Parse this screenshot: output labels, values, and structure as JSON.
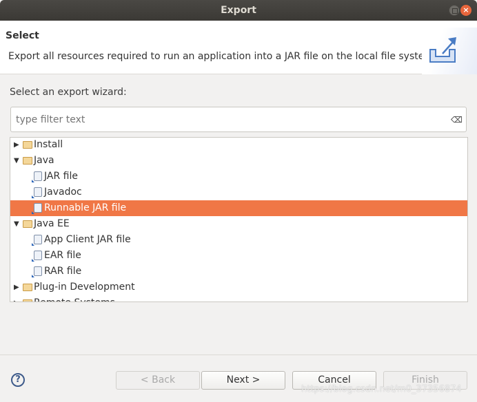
{
  "window": {
    "title": "Export",
    "close_glyph": "×"
  },
  "header": {
    "title": "Select",
    "description": "Export all resources required to run an application into a JAR file on the local file system."
  },
  "wizard_label": "Select an export wizard:",
  "filter": {
    "placeholder": "type filter text",
    "value": ""
  },
  "tree": [
    {
      "label": "Install",
      "type": "folder",
      "expanded": false,
      "level": 0
    },
    {
      "label": "Java",
      "type": "folder",
      "expanded": true,
      "level": 0
    },
    {
      "label": "JAR file",
      "type": "item",
      "level": 1
    },
    {
      "label": "Javadoc",
      "type": "item",
      "level": 1
    },
    {
      "label": "Runnable JAR file",
      "type": "item",
      "level": 1,
      "selected": true
    },
    {
      "label": "Java EE",
      "type": "folder",
      "expanded": true,
      "level": 0
    },
    {
      "label": "App Client JAR file",
      "type": "item",
      "level": 1
    },
    {
      "label": "EAR file",
      "type": "item",
      "level": 1
    },
    {
      "label": "RAR file",
      "type": "item",
      "level": 1
    },
    {
      "label": "Plug-in Development",
      "type": "folder",
      "expanded": false,
      "level": 0
    },
    {
      "label": "Remote Systems",
      "type": "folder",
      "expanded": false,
      "level": 0
    }
  ],
  "buttons": {
    "help": "?",
    "back": "< Back",
    "next": "Next >",
    "cancel": "Cancel",
    "finish": "Finish"
  },
  "watermark": "https://blog.csdn.net/m0_37356874",
  "colors": {
    "selection": "#f07746",
    "titlebar": "#3f3d39"
  }
}
